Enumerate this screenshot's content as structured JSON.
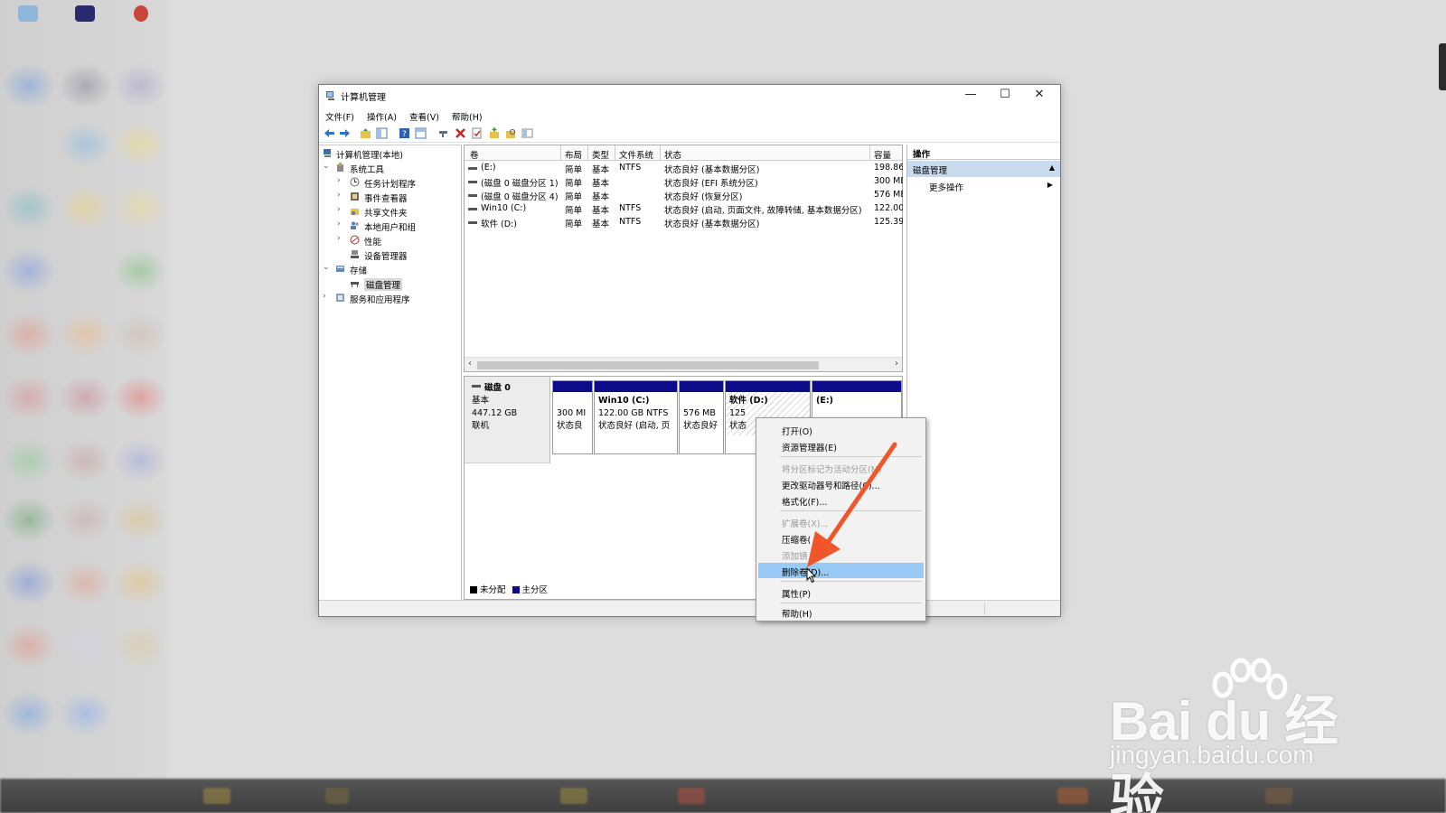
{
  "window": {
    "title": "计算机管理",
    "controls": {
      "minimize": "—",
      "maximize": "☐",
      "close": "✕"
    }
  },
  "menubar": [
    "文件(F)",
    "操作(A)",
    "查看(V)",
    "帮助(H)"
  ],
  "tree": {
    "root": "计算机管理(本地)",
    "system_tools": "系统工具",
    "task_scheduler": "任务计划程序",
    "event_viewer": "事件查看器",
    "shared_folders": "共享文件夹",
    "local_users": "本地用户和组",
    "performance": "性能",
    "device_manager": "设备管理器",
    "storage": "存储",
    "disk_management": "磁盘管理",
    "services_apps": "服务和应用程序"
  },
  "volume_table": {
    "headers": [
      "卷",
      "布局",
      "类型",
      "文件系统",
      "状态",
      "容量"
    ],
    "rows": [
      {
        "volume": "(E:)",
        "layout": "简单",
        "type": "基本",
        "fs": "NTFS",
        "status": "状态良好 (基本数据分区)",
        "capacity": "198.86"
      },
      {
        "volume": "(磁盘 0 磁盘分区 1)",
        "layout": "简单",
        "type": "基本",
        "fs": "",
        "status": "状态良好 (EFI 系统分区)",
        "capacity": "300 ME"
      },
      {
        "volume": "(磁盘 0 磁盘分区 4)",
        "layout": "简单",
        "type": "基本",
        "fs": "",
        "status": "状态良好 (恢复分区)",
        "capacity": "576 ME"
      },
      {
        "volume": "Win10 (C:)",
        "layout": "简单",
        "type": "基本",
        "fs": "NTFS",
        "status": "状态良好 (启动, 页面文件, 故障转储, 基本数据分区)",
        "capacity": "122.00"
      },
      {
        "volume": "软件 (D:)",
        "layout": "简单",
        "type": "基本",
        "fs": "NTFS",
        "status": "状态良好 (基本数据分区)",
        "capacity": "125.39"
      }
    ],
    "scroll_left": "‹",
    "scroll_right": "›"
  },
  "disk": {
    "name": "磁盘 0",
    "type": "基本",
    "size": "447.12 GB",
    "state": "联机",
    "partitions": [
      {
        "line1": "",
        "line2": "300 MI",
        "line3": "状态良"
      },
      {
        "line1": "Win10 (C:)",
        "line2": "122.00 GB NTFS",
        "line3": "状态良好 (启动, 页"
      },
      {
        "line1": "",
        "line2": "576 MB",
        "line3": "状态良好"
      },
      {
        "line1": "软件 (D:)",
        "line2": "125",
        "line3": "状态"
      },
      {
        "line1": "(E:)",
        "line2": "",
        "line3": ""
      }
    ]
  },
  "legend": {
    "unallocated": "未分配",
    "primary": "主分区"
  },
  "actions": {
    "header": "操作",
    "section": "磁盘管理",
    "more": "更多操作"
  },
  "context_menu": {
    "open": "打开(O)",
    "explorer": "资源管理器(E)",
    "mark_active": "将分区标记为活动分区(M)",
    "change_letter": "更改驱动器号和路径(C)...",
    "format": "格式化(F)...",
    "extend": "扩展卷(X)...",
    "shrink": "压缩卷(",
    "add_mirror": "添加镜",
    "delete": "删除卷(D)...",
    "properties": "属性(P)",
    "help": "帮助(H)"
  },
  "watermark": {
    "brand": "Bai du 经验",
    "url": "jingyan.baidu.com"
  },
  "colors": {
    "partition_bar": "#0c0c8a",
    "highlight": "#99c9f5",
    "section_bg": "#c9dcef",
    "arrow": "#f0562a"
  }
}
